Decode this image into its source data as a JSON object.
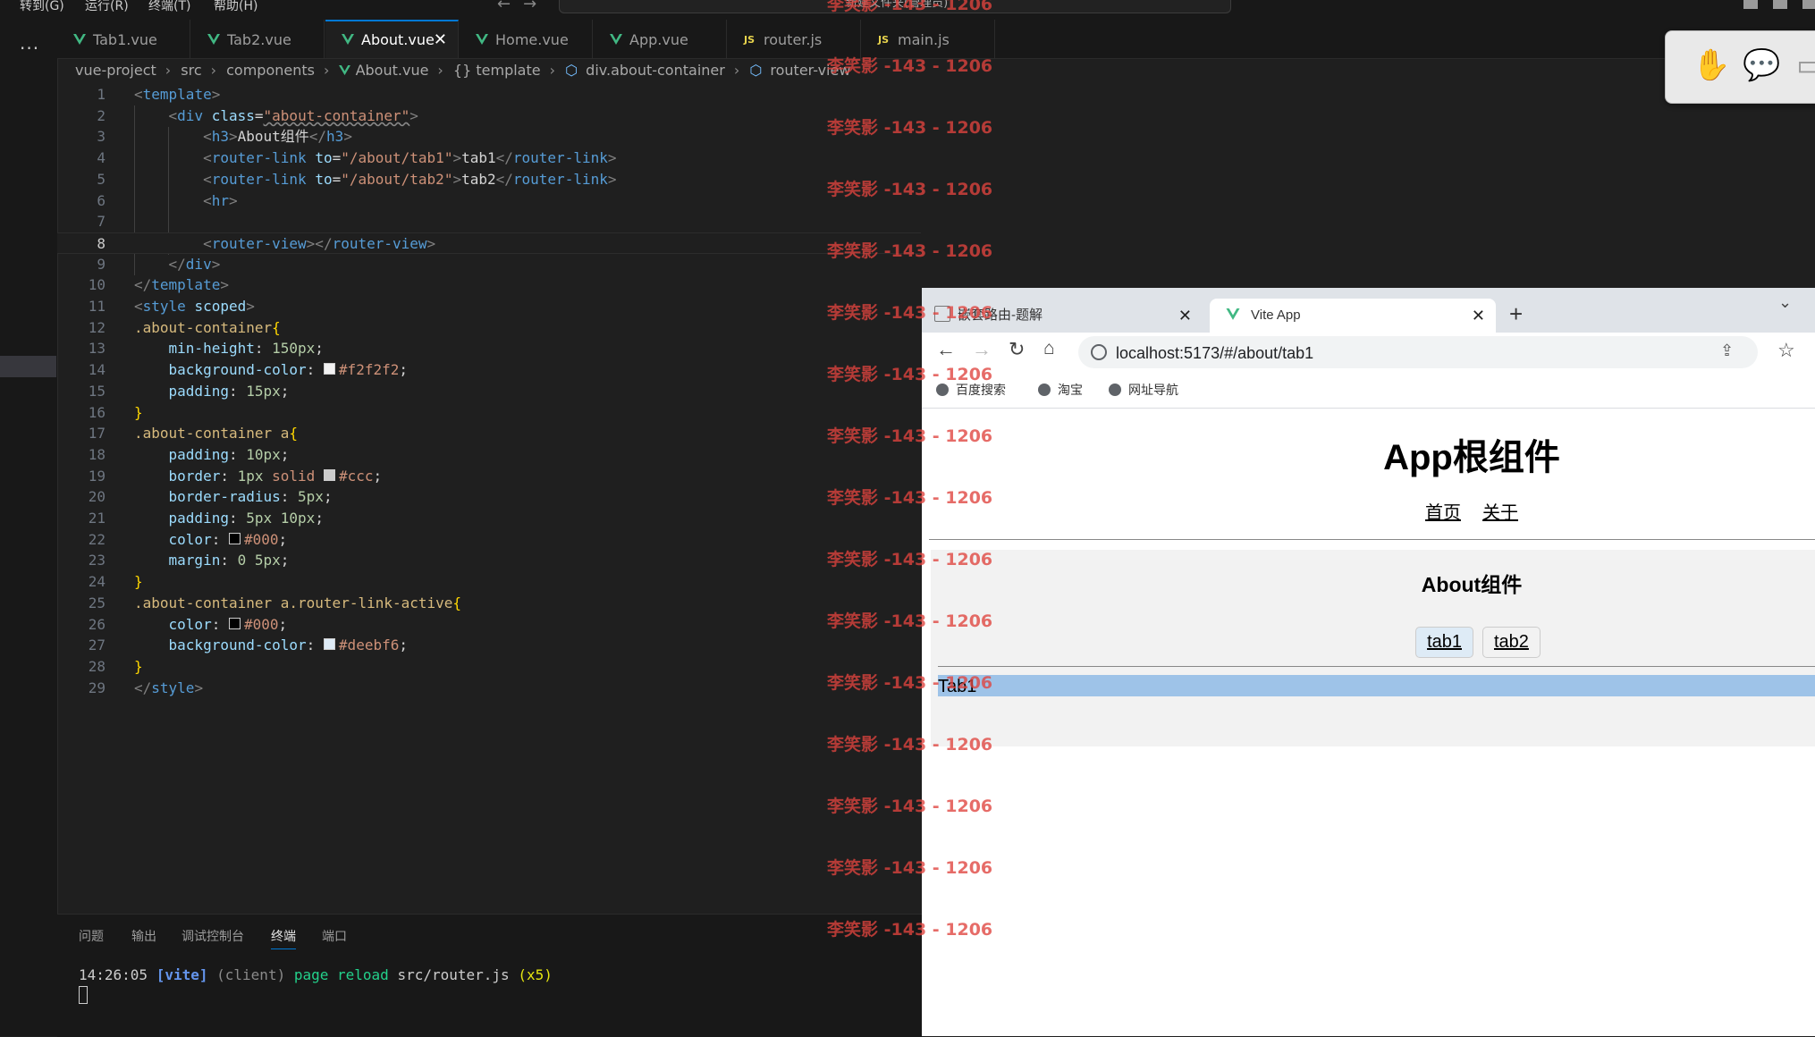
{
  "menu": [
    "转到(G)",
    "运行(R)",
    "终端(T)",
    "帮助(H)"
  ],
  "command_center": "新建文件夹(管理员)",
  "tabs": [
    {
      "label": "Tab1.vue",
      "type": "vue"
    },
    {
      "label": "Tab2.vue",
      "type": "vue"
    },
    {
      "label": "About.vue",
      "type": "vue",
      "active": true
    },
    {
      "label": "Home.vue",
      "type": "vue"
    },
    {
      "label": "App.vue",
      "type": "vue"
    },
    {
      "label": "router.js",
      "type": "js"
    },
    {
      "label": "main.js",
      "type": "js"
    }
  ],
  "js_badge": "JS",
  "breadcrumb": [
    "vue-project",
    "src",
    "components",
    "About.vue",
    "{} template",
    "div.about-container",
    "router-view"
  ],
  "editor": {
    "current_line": 8,
    "lines": [
      "1",
      "2",
      "3",
      "4",
      "5",
      "6",
      "7",
      "8",
      "9",
      "10",
      "11",
      "12",
      "13",
      "14",
      "15",
      "16",
      "17",
      "18",
      "19",
      "20",
      "21",
      "22",
      "23",
      "24",
      "25",
      "26",
      "27",
      "28",
      "29"
    ],
    "code": {
      "l1": "template",
      "l2_tag": "div",
      "l2_attr": "class",
      "l2_val": "\"about-container\"",
      "l3_tag": "h3",
      "l3_text": "About组件",
      "l4_tag": "router-link",
      "l4_attr": "to",
      "l4_val": "\"/about/tab1\"",
      "l4_text": "tab1",
      "l5_tag": "router-link",
      "l5_attr": "to",
      "l5_val": "\"/about/tab2\"",
      "l5_text": "tab2",
      "l6_tag": "hr",
      "l8_tag": "router-view",
      "l9_tag": "div",
      "l10_tag": "template",
      "l11_tag": "style",
      "l11_attr": "scoped",
      "l12_sel": ".about-container",
      "l13_prop": "min-height",
      "l13_val": "150px",
      "l14_prop": "background-color",
      "l14_val": "#f2f2f2",
      "l15_prop": "padding",
      "l15_val": "15px",
      "l17_sel": ".about-container a",
      "l18_prop": "padding",
      "l18_val": "10px",
      "l19_prop": "border",
      "l19_val_a": "1px",
      "l19_val_b": "solid",
      "l19_val_c": "#ccc",
      "l20_prop": "border-radius",
      "l20_val": "5px",
      "l21_prop": "padding",
      "l21_val_a": "5px",
      "l21_val_b": "10px",
      "l22_prop": "color",
      "l22_val": "#000",
      "l23_prop": "margin",
      "l23_val_a": "0",
      "l23_val_b": "5px",
      "l25_sel": ".about-container a.router-link-active",
      "l26_prop": "color",
      "l26_val": "#000",
      "l27_prop": "background-color",
      "l27_val": "#deebf6",
      "l29_tag": "style"
    }
  },
  "panel": {
    "tabs": [
      "问题",
      "输出",
      "调试控制台",
      "终端",
      "端口"
    ],
    "active_tab": "终端",
    "terminal": {
      "time": "14:26:05",
      "tag": "[vite]",
      "client": "(client)",
      "msg": "page reload",
      "file": "src/router.js",
      "count": "(x5)"
    }
  },
  "watermark": "李笑影 -143 - 1206",
  "browser": {
    "tabs": [
      {
        "title": "嵌套路由-题解"
      },
      {
        "title": "Vite App",
        "active": true
      }
    ],
    "new_tab": "+",
    "url": "localhost:5173/#/about/tab1",
    "bookmarks": [
      "百度搜索",
      "淘宝",
      "网址导航"
    ],
    "page": {
      "title": "App根组件",
      "nav": [
        "首页",
        "关于"
      ],
      "about_heading": "About组件",
      "about_links": [
        "tab1",
        "tab2"
      ],
      "active_link": "tab1",
      "view_text": "Tab1"
    }
  },
  "colors": {
    "accent": "#0078d4",
    "editor_bg": "#1f1f1f",
    "active_link_bg": "#deebf6",
    "about_bg": "#f2f2f2",
    "watermark": "#e0443e"
  }
}
